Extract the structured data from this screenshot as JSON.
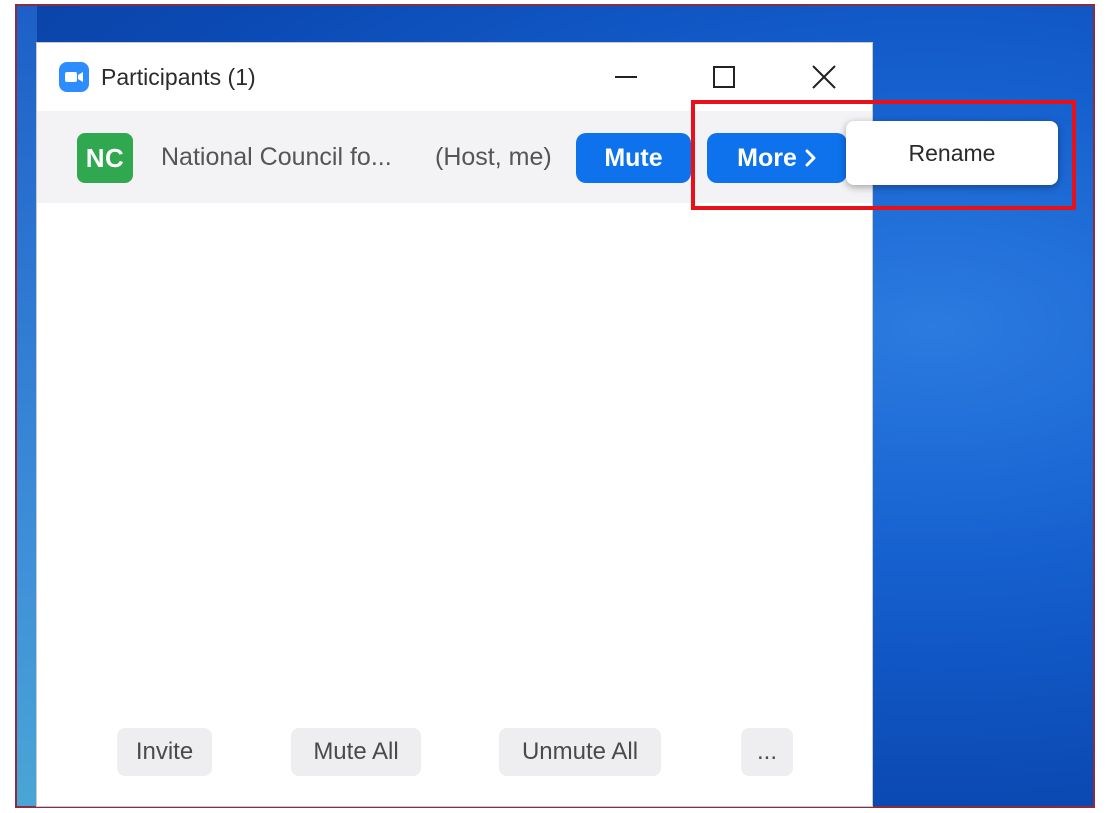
{
  "window": {
    "title": "Participants (1)",
    "icon": "zoom-camera-icon"
  },
  "window_controls": {
    "minimize_icon": "minimize-icon",
    "maximize_icon": "maximize-icon",
    "close_icon": "close-icon"
  },
  "participant": {
    "initials": "NC",
    "avatar_color": "#2fa84f",
    "name": "National Council fo...",
    "role": "(Host, me)",
    "mute_label": "Mute",
    "more_label": "More",
    "more_icon": "chevron-right-icon"
  },
  "context_menu": {
    "items": [
      {
        "label": "Rename"
      }
    ]
  },
  "toolbar": {
    "invite_label": "Invite",
    "mute_all_label": "Mute All",
    "unmute_all_label": "Unmute All",
    "more_label": "..."
  },
  "colors": {
    "accent_blue": "#0e72ed",
    "highlight_red": "#e8111a",
    "desktop_blue": "#1560cf"
  }
}
